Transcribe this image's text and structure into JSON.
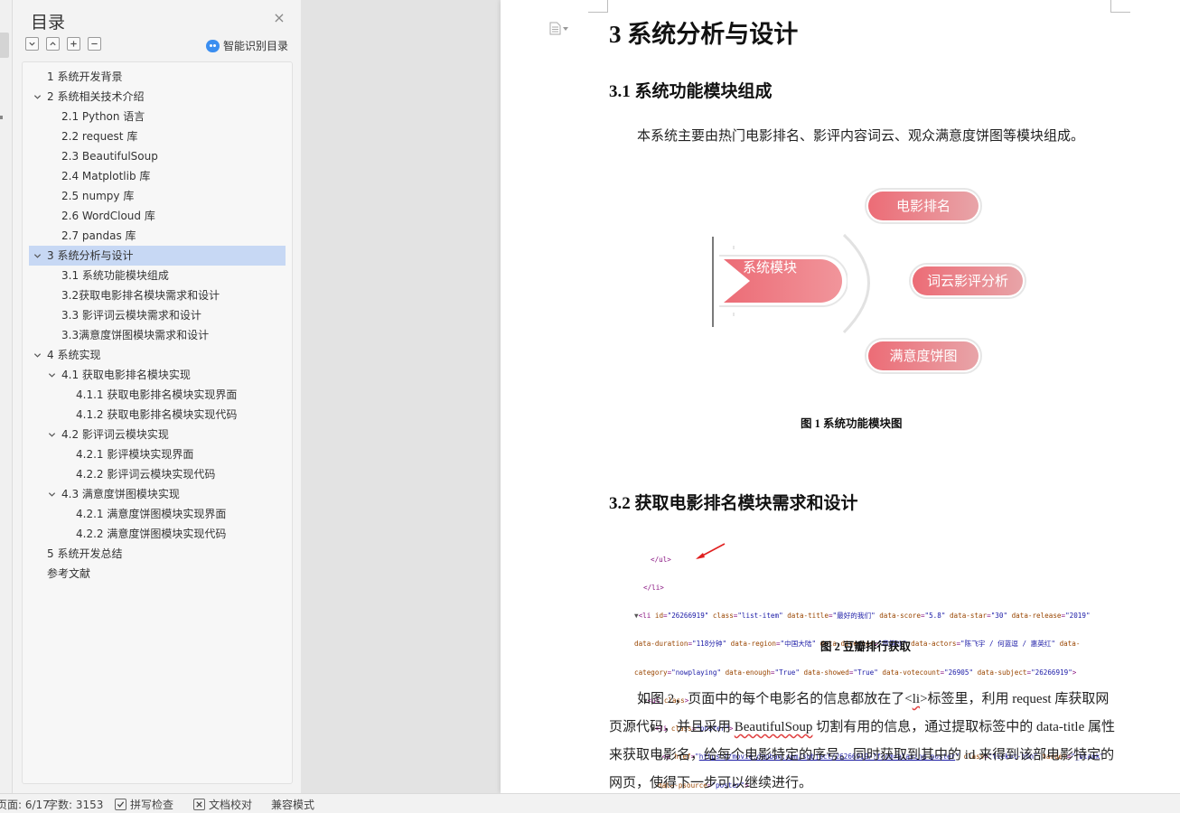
{
  "toc": {
    "title": "目录",
    "smart_label": "智能识别目录",
    "items": [
      {
        "label": "1 系统开发背景",
        "level": 1,
        "expandable": false,
        "active": false
      },
      {
        "label": "2 系统相关技术介绍",
        "level": 1,
        "expandable": true,
        "active": false
      },
      {
        "label": "2.1 Python 语言",
        "level": 2,
        "expandable": false,
        "active": false
      },
      {
        "label": "2.2 request 库",
        "level": 2,
        "expandable": false,
        "active": false
      },
      {
        "label": "2.3 BeautifulSoup",
        "level": 2,
        "expandable": false,
        "active": false
      },
      {
        "label": "2.4 Matplotlib 库",
        "level": 2,
        "expandable": false,
        "active": false
      },
      {
        "label": "2.5 numpy 库",
        "level": 2,
        "expandable": false,
        "active": false
      },
      {
        "label": "2.6 WordCloud 库",
        "level": 2,
        "expandable": false,
        "active": false
      },
      {
        "label": "2.7 pandas 库",
        "level": 2,
        "expandable": false,
        "active": false
      },
      {
        "label": "3 系统分析与设计",
        "level": 1,
        "expandable": true,
        "active": true
      },
      {
        "label": "3.1 系统功能模块组成",
        "level": 2,
        "expandable": false,
        "active": false
      },
      {
        "label": "3.2获取电影排名模块需求和设计",
        "level": 2,
        "expandable": false,
        "active": false
      },
      {
        "label": "3.3 影评词云模块需求和设计",
        "level": 2,
        "expandable": false,
        "active": false
      },
      {
        "label": "3.3满意度饼图模块需求和设计",
        "level": 2,
        "expandable": false,
        "active": false
      },
      {
        "label": "4 系统实现",
        "level": 1,
        "expandable": true,
        "active": false
      },
      {
        "label": "4.1  获取电影排名模块实现",
        "level": 2,
        "expandable": true,
        "active": false
      },
      {
        "label": "4.1.1  获取电影排名模块实现界面",
        "level": 3,
        "expandable": false,
        "active": false
      },
      {
        "label": "4.1.2  获取电影排名模块实现代码",
        "level": 3,
        "expandable": false,
        "active": false
      },
      {
        "label": "4.2  影评词云模块实现",
        "level": 2,
        "expandable": true,
        "active": false
      },
      {
        "label": "4.2.1  影评模块实现界面",
        "level": 3,
        "expandable": false,
        "active": false
      },
      {
        "label": "4.2.2  影评词云模块实现代码",
        "level": 3,
        "expandable": false,
        "active": false
      },
      {
        "label": "4.3  满意度饼图模块实现",
        "level": 2,
        "expandable": true,
        "active": false
      },
      {
        "label": "4.2.1  满意度饼图模块实现界面",
        "level": 3,
        "expandable": false,
        "active": false
      },
      {
        "label": "4.2.2  满意度饼图模块实现代码",
        "level": 3,
        "expandable": false,
        "active": false
      },
      {
        "label": "5 系统开发总结",
        "level": 1,
        "expandable": false,
        "active": false
      },
      {
        "label": "参考文献",
        "level": 1,
        "expandable": false,
        "active": false
      }
    ]
  },
  "document": {
    "h1": "3 系统分析与设计",
    "h2_1": "3.1 系统功能模块组成",
    "para1": "本系统主要由热门电影排名、影评内容词云、观众满意度饼图等模块组成。",
    "diagram": {
      "main": "系统模块",
      "modules": [
        "电影排名",
        "词云影评分析",
        "满意度饼图"
      ]
    },
    "fig1_caption": "图 1  系统功能模块图",
    "h2_2": "3.2 获取电影排名模块需求和设计",
    "fig2_caption": "图 2  豆瓣排行获取",
    "para2_parts": {
      "a": "如图 2，页面中的每个电影名的信息都放在了<",
      "li": "li",
      "b": ">标签里，利用 request 库获取网页源代码，并且采用 ",
      "bs": "BeautifulSoup",
      "c": " 切割有用的信息，通过提取标签中的 data-title 属性来获取电影名，给每个电影特定的序号。同时获取到其中的 id 来得到该部电影特定的网页，使得下一步可以继续进行。"
    },
    "code": {
      "l1": "</ul>",
      "l2": "</li>",
      "id": "26266919",
      "title": "最好的我们",
      "score": "5.8",
      "star": "30",
      "release": "2019",
      "duration": "118分钟",
      "region": "中国大陆",
      "director": "章笛沙",
      "actors": "陈飞宇 / 何蓝逗 / 惠英红",
      "category": "nowplaying",
      "enough": "True",
      "showed": "True",
      "votecount": "26905",
      "subject": "26266919",
      "href": "https://movie.douban.com/subject/26266919/?from=playing_poster",
      "class_btn": "ticket-btn",
      "target": "_blank",
      "psource": "poster"
    }
  },
  "status": {
    "page": "页面: 6/17",
    "words": "字数: 3153",
    "spell": "拼写检查",
    "proof": "文档校对",
    "compat": "兼容模式"
  },
  "colors": {
    "accent_pill_start": "#ec6c76",
    "accent_pill_end": "#e8a4a8",
    "toc_active": "#c7d8f4",
    "ai_icon": "#3b8ef0"
  }
}
